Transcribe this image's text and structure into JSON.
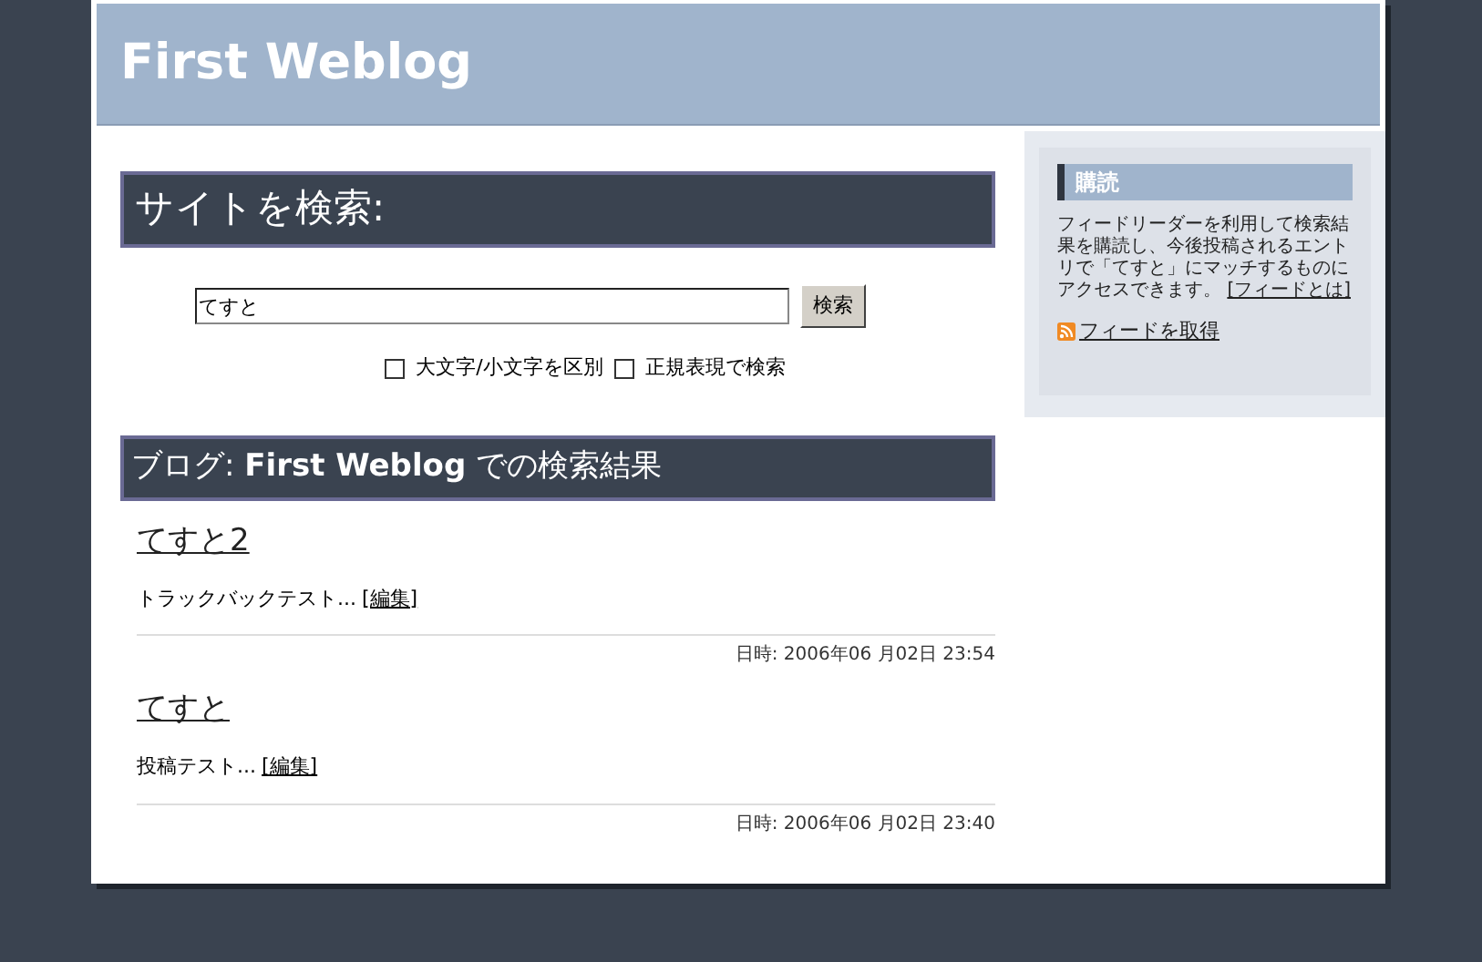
{
  "blog_title": "First Weblog",
  "search": {
    "heading": "サイトを検索:",
    "value": "てすと",
    "button": "検索",
    "options": [
      {
        "label": "大文字/小文字を区別",
        "checked": false
      },
      {
        "label": "正規表現で検索",
        "checked": false
      }
    ]
  },
  "results": {
    "heading": "ブログ: **First Weblog** での検索結果",
    "entries": [
      {
        "title": "てすと2",
        "excerpt": "トラックバックテスト...",
        "edit": "[編集]",
        "date": "日時: 2006年06 月02日 23:54"
      },
      {
        "title": "てすと",
        "excerpt": "投稿テスト...",
        "edit": "[編集]",
        "date": "日時: 2006年06 月02日 23:40"
      }
    ]
  },
  "sidebar": {
    "heading": "購読",
    "text": "フィードリーダーを利用して検索結果を購読し、今後投稿されるエントリで「てすと」にマッチするものにアクセスできます。",
    "about_link": "[フィードとは]",
    "feed_link": "フィードを取得"
  }
}
